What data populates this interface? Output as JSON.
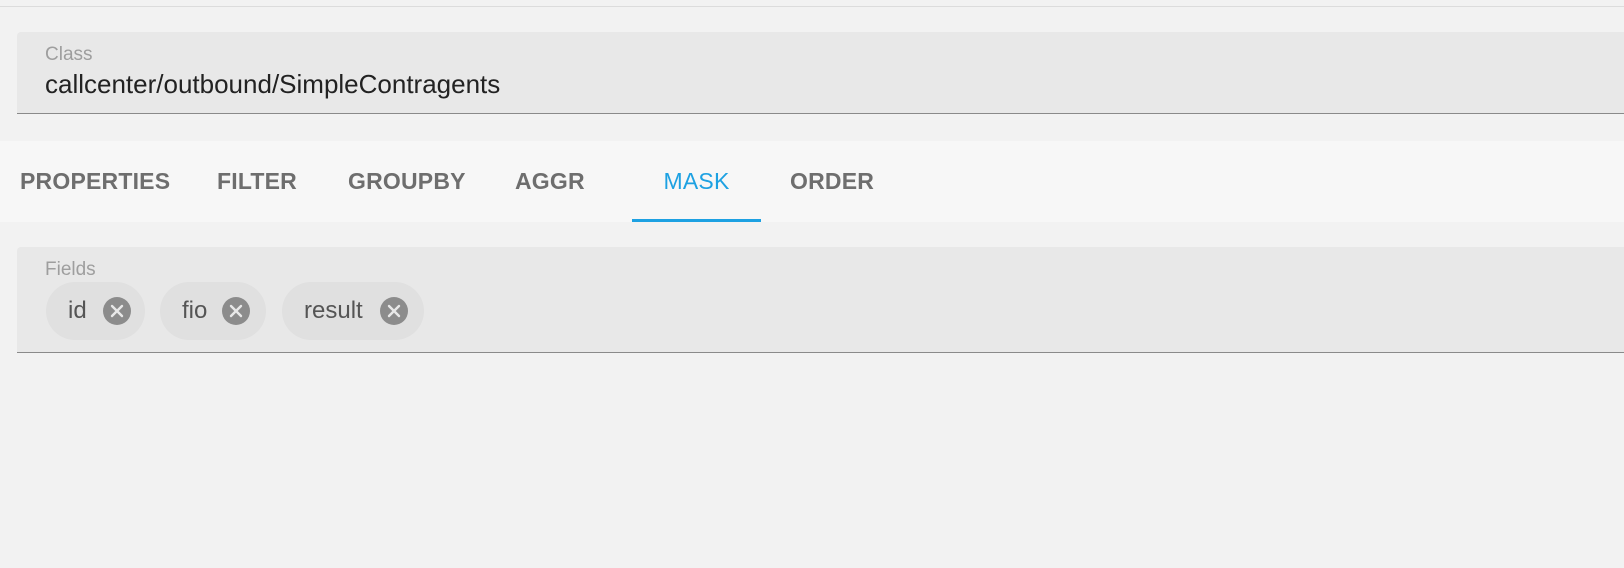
{
  "class_field": {
    "label": "Class",
    "value": "callcenter/outbound/SimpleContragents"
  },
  "tabs": [
    {
      "label": "PROPERTIES",
      "active": false
    },
    {
      "label": "FILTER",
      "active": false
    },
    {
      "label": "GROUPBY",
      "active": false
    },
    {
      "label": "AGGR",
      "active": false
    },
    {
      "label": "MASK",
      "active": true
    },
    {
      "label": "ORDER",
      "active": false
    }
  ],
  "fields_field": {
    "label": "Fields",
    "chips": [
      {
        "label": "id",
        "icon": "close-circle-icon"
      },
      {
        "label": "fio",
        "icon": "close-circle-icon"
      },
      {
        "label": "result",
        "icon": "close-circle-icon"
      }
    ]
  },
  "colors": {
    "accent": "#1da1e2",
    "background": "#f2f2f2",
    "field_background": "#e8e8e8",
    "chip_background": "#e0e0e0"
  }
}
